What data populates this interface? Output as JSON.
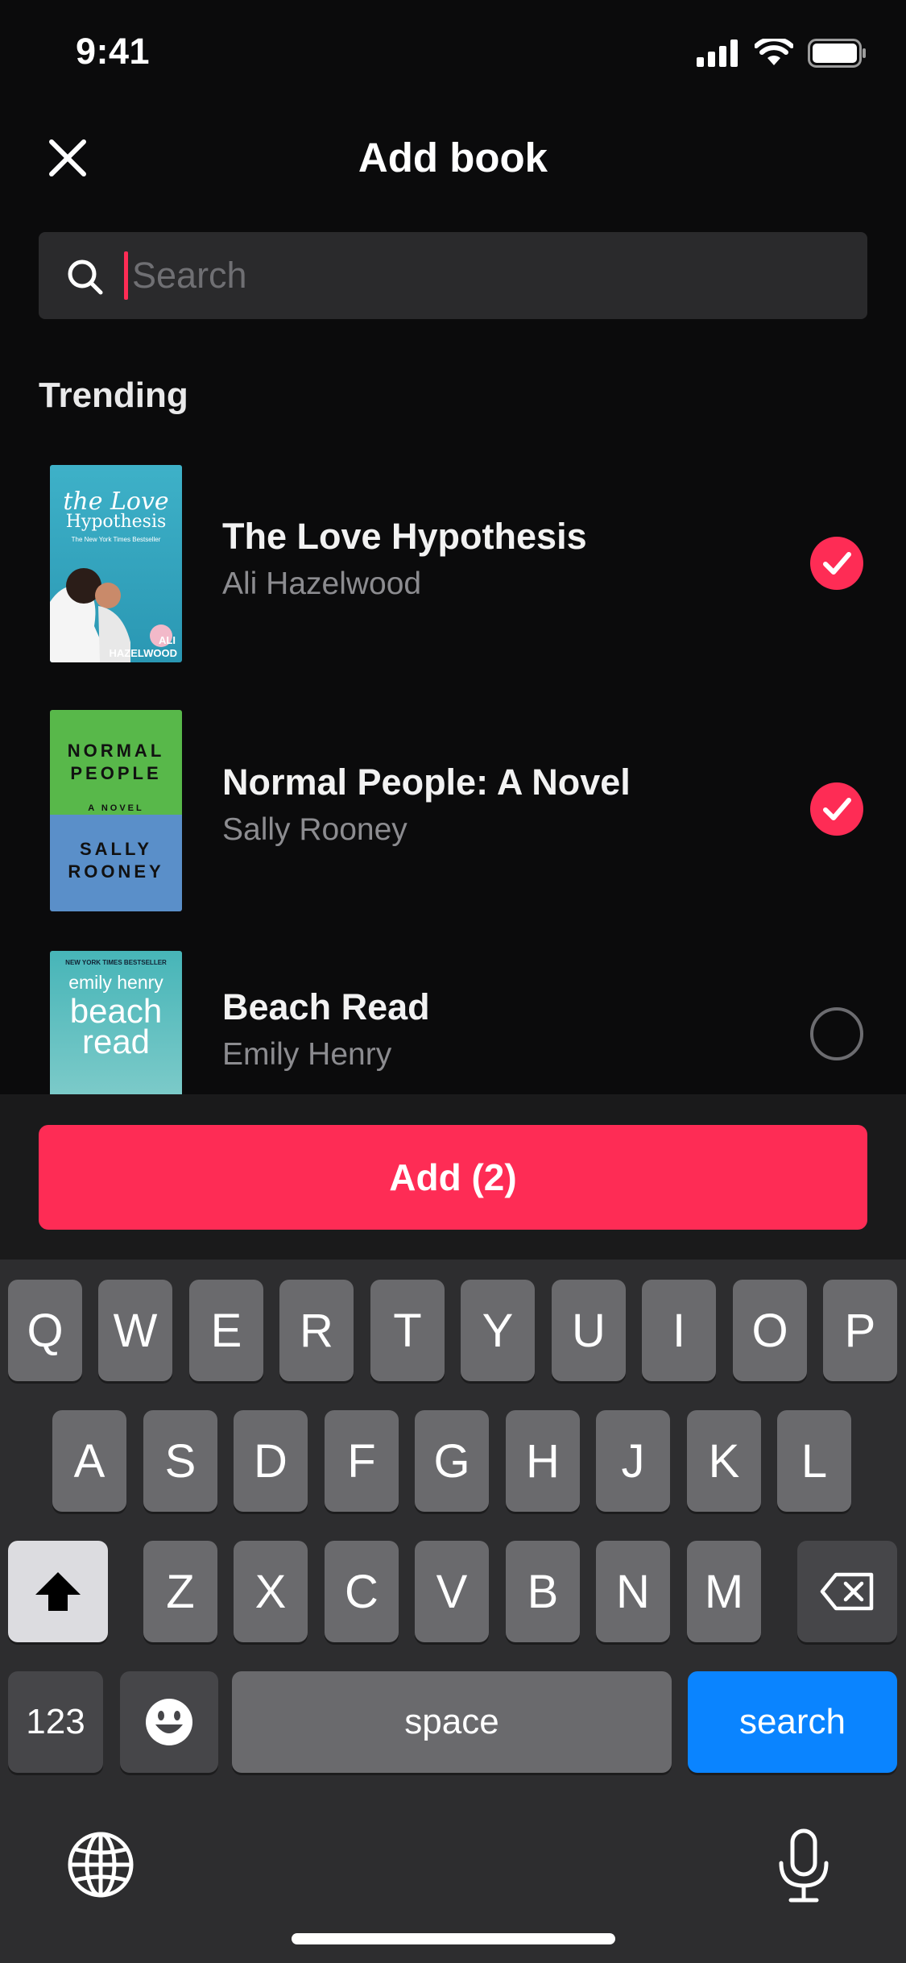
{
  "status_bar": {
    "time": "9:41"
  },
  "header": {
    "title": "Add book"
  },
  "search": {
    "placeholder": "Search",
    "value": ""
  },
  "section": {
    "title": "Trending"
  },
  "books": [
    {
      "title": "The Love Hypothesis",
      "author": "Ali Hazelwood",
      "selected": true,
      "cover": {
        "line1": "the Love",
        "line2": "Hypothesis",
        "line3": "The New York Times Bestseller",
        "line4": "ALI",
        "line5": "HAZELWOOD"
      }
    },
    {
      "title": "Normal People: A Novel",
      "author": "Sally Rooney",
      "selected": true,
      "cover": {
        "line1": "NORMAL",
        "line2": "PEOPLE",
        "line3": "A NOVEL",
        "line4": "SALLY",
        "line5": "ROONEY"
      }
    },
    {
      "title": "Beach Read",
      "author": "Emily Henry",
      "selected": false,
      "cover": {
        "line1": "NEW YORK TIMES BESTSELLER",
        "line2": "emily henry",
        "line3": "beach",
        "line4": "read",
        "line5": ""
      }
    }
  ],
  "add_button": {
    "label": "Add (2)"
  },
  "keyboard": {
    "row1": [
      "Q",
      "W",
      "E",
      "R",
      "T",
      "Y",
      "U",
      "I",
      "O",
      "P"
    ],
    "row2": [
      "A",
      "S",
      "D",
      "F",
      "G",
      "H",
      "J",
      "K",
      "L"
    ],
    "row3": [
      "Z",
      "X",
      "C",
      "V",
      "B",
      "N",
      "M"
    ],
    "numbers_label": "123",
    "space_label": "space",
    "return_label": "search"
  },
  "colors": {
    "accent": "#fe2c55",
    "background": "#0b0b0c",
    "key": "#6a6a6d",
    "return_key": "#0a84ff"
  },
  "icons": [
    "close-icon",
    "search-icon",
    "checkmark-icon",
    "shift-icon",
    "delete-icon",
    "emoji-icon",
    "globe-icon",
    "microphone-icon"
  ]
}
